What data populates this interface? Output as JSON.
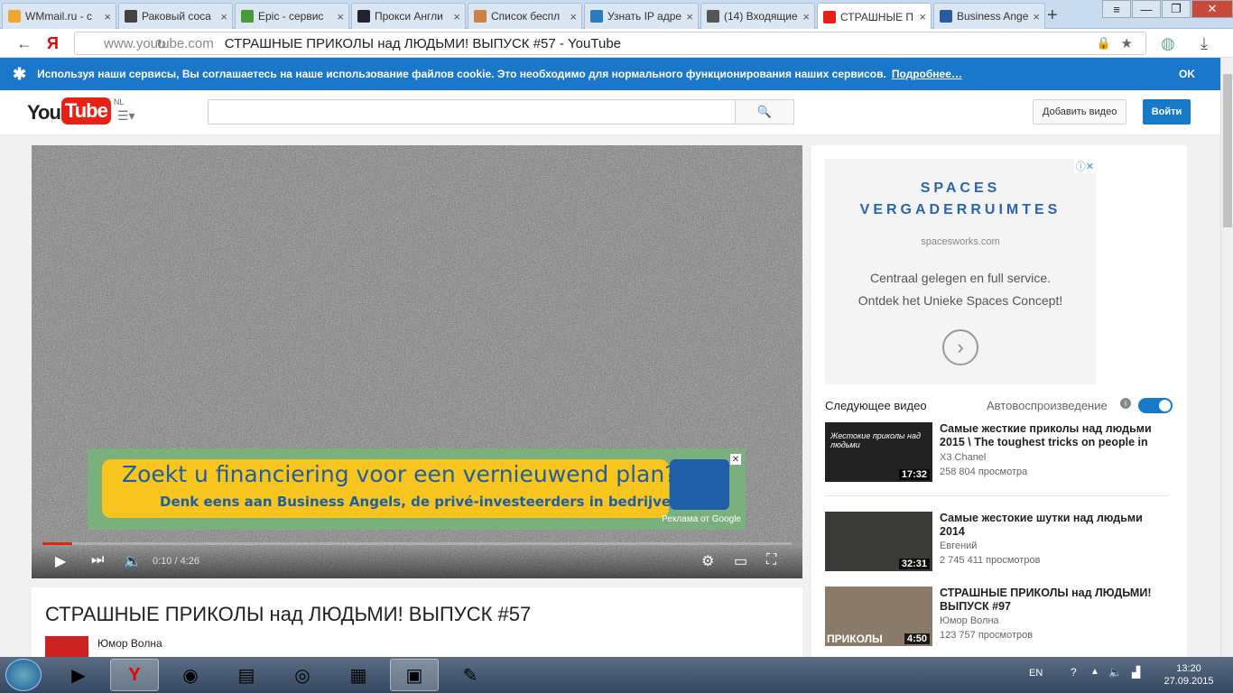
{
  "browser": {
    "tabs": [
      {
        "label": "WMmail.ru - с",
        "color": "#f0a830"
      },
      {
        "label": "Раковый соса",
        "color": "#444444"
      },
      {
        "label": "Epic - сервис ",
        "color": "#4a9a3a"
      },
      {
        "label": "Прокси Англи",
        "color": "#222233"
      },
      {
        "label": "Список беспл",
        "color": "#d08040"
      },
      {
        "label": "Узнать IP адре",
        "color": "#2a7ac0"
      },
      {
        "label": "(14) Входящие",
        "color": "#555555"
      },
      {
        "label": "СТРАШНЫЕ П",
        "color": "#e62117"
      },
      {
        "label": "Business Ange",
        "color": "#2a5aa0"
      }
    ],
    "address_host": "www.youtube.com",
    "address_title": "СТРАШНЫЕ ПРИКОЛЫ над ЛЮДЬМИ! ВЫПУСК #57 - YouTube"
  },
  "cookie_bar": {
    "text": "Используя наши сервисы, Вы соглашаетесь на наше использование файлов cookie. Это необходимо для нормального функционирования наших сервисов.",
    "link": "Подробнее…",
    "ok": "OK"
  },
  "header": {
    "logo_you": "You",
    "logo_tube": "Tube",
    "region": "NL",
    "upload_label": "Добавить видео",
    "signin_label": "Войти"
  },
  "player": {
    "time": "0:10 / 4:26",
    "progress": 0.04,
    "ad": {
      "title": "Zoekt u financiering voor een vernieuwend plan?",
      "subtitle": "Denk eens aan Business Angels, de privé-investeerders in bedrijven.",
      "credit": "Реклама от Google"
    }
  },
  "video": {
    "title": "СТРАШНЫЕ ПРИКОЛЫ над ЛЮДЬМИ! ВЫПУСК #57",
    "channel": "Юмор Волна"
  },
  "side_ad": {
    "line1": "SPACES",
    "line2": "VERGADERRUIMTES",
    "domain": "spacesworks.com",
    "text1": "Centraal gelegen en full service.",
    "text2": "Ontdek het Unieke Spaces Concept!"
  },
  "sidebar": {
    "next_label": "Следующее видео",
    "autoplay_label": "Автовоспроизведение",
    "items": [
      {
        "title": "Самые жесткие приколы над людьми 2015 \\ The toughest tricks on people in",
        "channel": "X3 Chanel",
        "views": "258 804 просмотра",
        "duration": "17:32",
        "thumb_text": "Жестокие приколы над людьми"
      },
      {
        "title": "Самые жестокие шутки над людьми 2014",
        "channel": "Евгений",
        "views": "2 745 411 просмотров",
        "duration": "32:31",
        "thumb_text": ""
      },
      {
        "title": "СТРАШНЫЕ ПРИКОЛЫ над ЛЮДЬМИ! ВЫПУСК #97",
        "channel": "Юмор Волна",
        "views": "123 757 просмотров",
        "duration": "4:50",
        "thumb_text": "ПРИКОЛЫ"
      }
    ]
  },
  "taskbar": {
    "lang": "EN",
    "time": "13:20",
    "date": "27.09.2015"
  }
}
